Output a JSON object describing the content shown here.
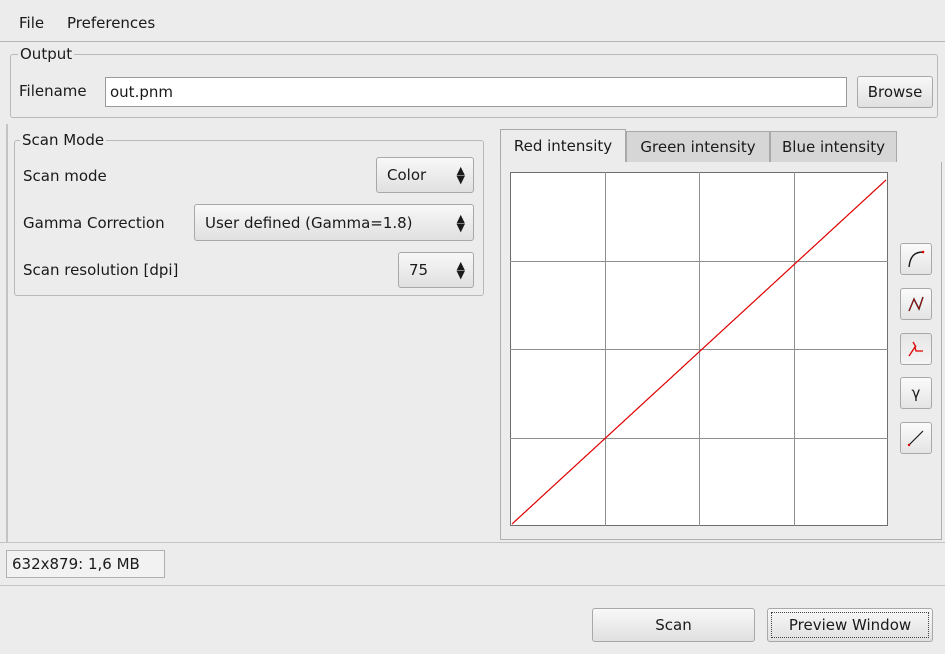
{
  "menubar": {
    "file": "File",
    "preferences": "Preferences"
  },
  "output": {
    "title": "Output",
    "filename_label": "Filename",
    "filename_value": "out.pnm",
    "browse_label": "Browse"
  },
  "scan_mode": {
    "title": "Scan Mode",
    "mode_label": "Scan mode",
    "mode_value": "Color",
    "gamma_label": "Gamma Correction",
    "gamma_value": "User defined (Gamma=1.8)",
    "resolution_label": "Scan resolution [dpi]",
    "resolution_value": "75"
  },
  "tabs": [
    {
      "label": "Red intensity",
      "active": true
    },
    {
      "label": "Green intensity",
      "active": false
    },
    {
      "label": "Blue intensity",
      "active": false
    }
  ],
  "curve_tools": [
    {
      "name": "curve-freehand-tool-icon"
    },
    {
      "name": "curve-spline-tool-icon"
    },
    {
      "name": "curve-point-tool-icon",
      "pressed": true
    },
    {
      "name": "gamma-tool-icon",
      "glyph": "γ"
    },
    {
      "name": "linear-reset-tool-icon"
    }
  ],
  "curve": {
    "color": "#e00000",
    "x_range": [
      0,
      255
    ],
    "y_range": [
      0,
      255
    ],
    "grid_divisions": 4
  },
  "status": {
    "size_text": "632x879: 1,6 MB"
  },
  "actions": {
    "scan_label": "Scan",
    "preview_label": "Preview Window"
  }
}
